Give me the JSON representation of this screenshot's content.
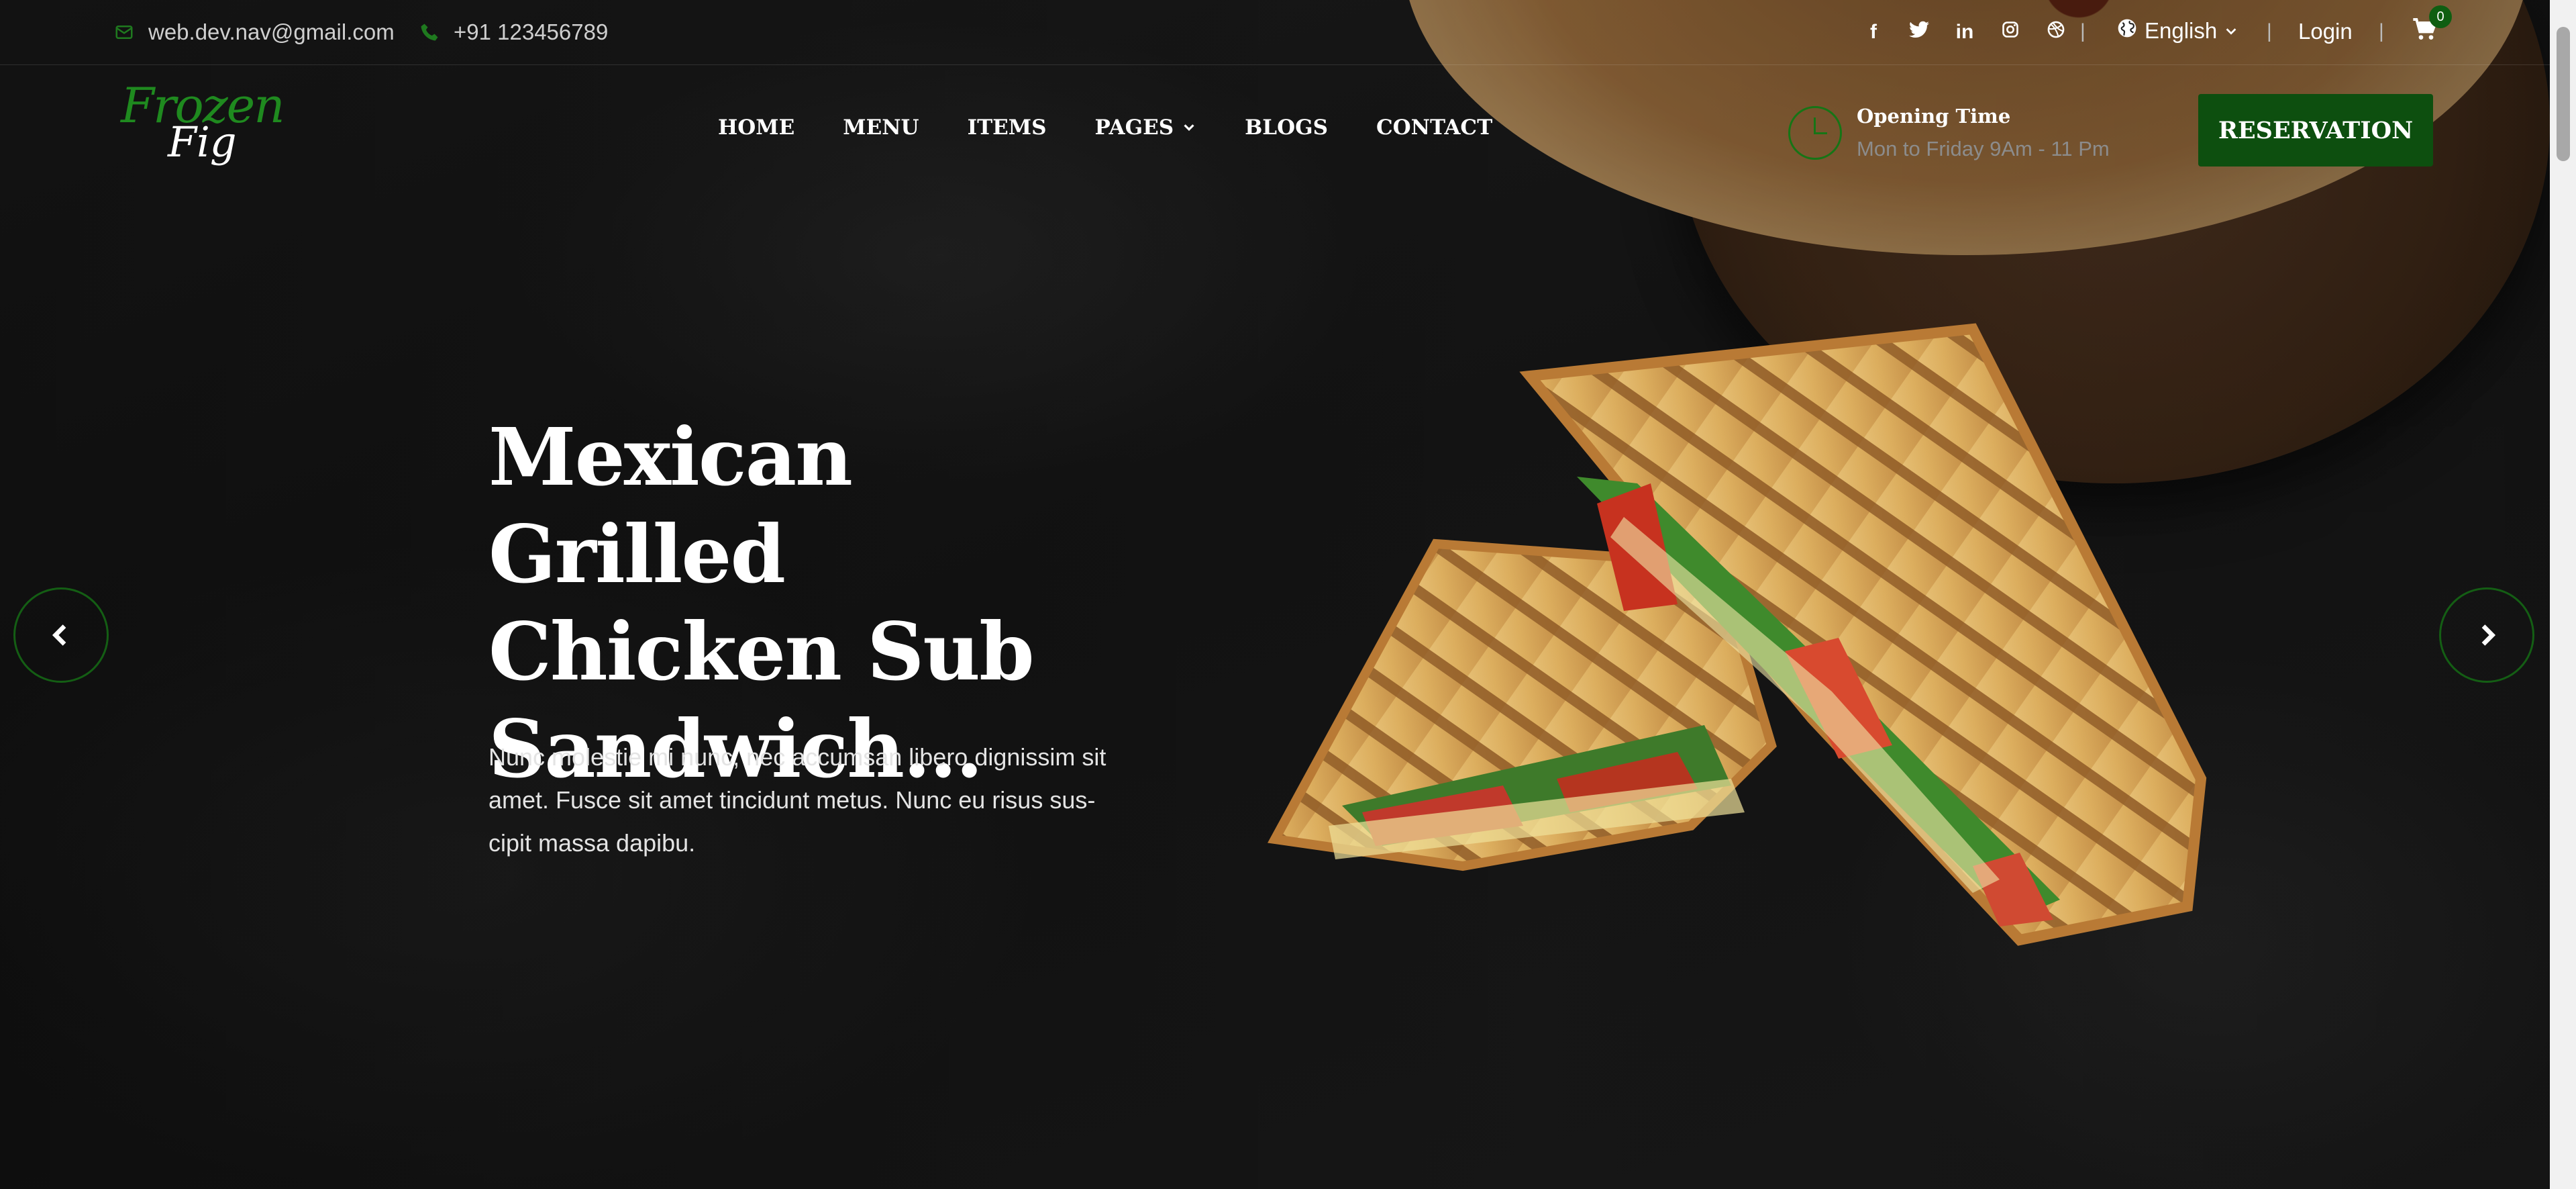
{
  "topbar": {
    "email": "web.dev.nav@gmail.com",
    "phone": "+91 123456789",
    "social_icons": [
      "facebook-icon",
      "twitter-icon",
      "linkedin-icon",
      "instagram-icon",
      "dribbble-icon"
    ],
    "separator": "|",
    "language": "English",
    "login": "Login",
    "cart_count": "0"
  },
  "logo": {
    "line1": "Frozen",
    "line2": "Fig"
  },
  "nav": {
    "items": [
      "HOME",
      "MENU",
      "ITEMS",
      "PAGES",
      "BLOGS",
      "CONTACT"
    ]
  },
  "opening": {
    "title": "Opening Time",
    "hours": "Mon to Friday 9Am - 11 Pm"
  },
  "reservation_label": "RESERVATION",
  "hero": {
    "title": "Mexican Grilled Chicken Sub Sandwich...",
    "text": "Nunc molestie mi nunc, nec accumsan libero dignissim sit amet. Fusce sit amet tincidunt metus. Nunc eu risus sus-cipit massa dapibu."
  },
  "colors": {
    "brand_green": "#0d4f0f",
    "accent_green": "#1f8a1f"
  }
}
